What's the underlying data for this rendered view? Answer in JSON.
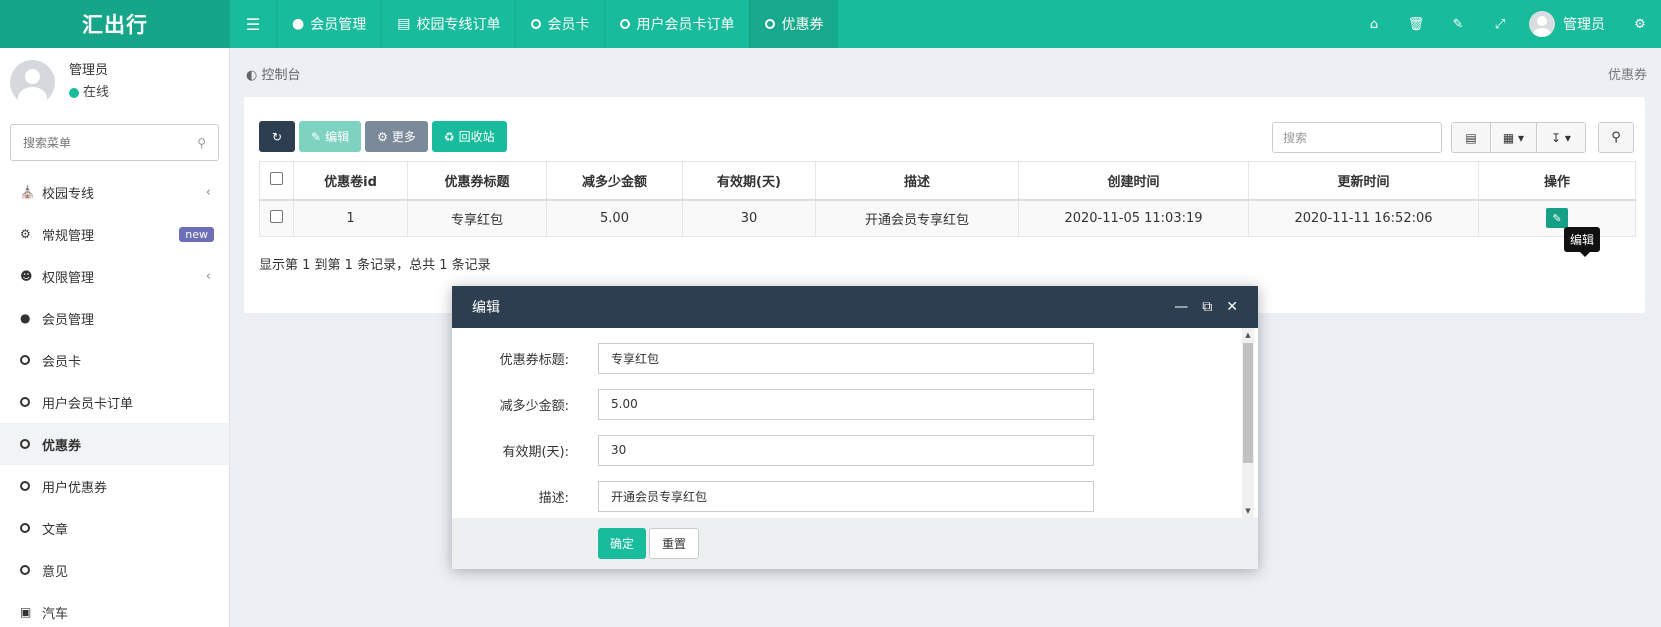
{
  "app": {
    "logo": "汇出行"
  },
  "topnav": {
    "items": [
      {
        "label": "会员管理",
        "icon": "user-icon"
      },
      {
        "label": "校园专线订单",
        "icon": "server-icon"
      },
      {
        "label": "会员卡",
        "icon": "circle-o-icon"
      },
      {
        "label": "用户会员卡订单",
        "icon": "circle-o-icon"
      },
      {
        "label": "优惠券",
        "icon": "circle-o-icon",
        "active": true
      }
    ],
    "user_name": "管理员"
  },
  "sidebar": {
    "user_name": "管理员",
    "user_status": "在线",
    "search_placeholder": "搜索菜单",
    "items": [
      {
        "label": "校园专线",
        "icon": "bank-icon",
        "has_arrow": true
      },
      {
        "label": "常规管理",
        "icon": "cogs-icon",
        "badge": "new"
      },
      {
        "label": "权限管理",
        "icon": "group-icon",
        "has_arrow": true
      },
      {
        "label": "会员管理",
        "icon": "user-icon"
      },
      {
        "label": "会员卡",
        "icon": "circle-o-icon"
      },
      {
        "label": "用户会员卡订单",
        "icon": "circle-o-icon"
      },
      {
        "label": "优惠券",
        "icon": "circle-o-icon",
        "active": true
      },
      {
        "label": "用户优惠券",
        "icon": "circle-o-icon"
      },
      {
        "label": "文章",
        "icon": "circle-o-icon"
      },
      {
        "label": "意见",
        "icon": "circle-o-icon"
      },
      {
        "label": "汽车",
        "icon": "car-icon"
      }
    ]
  },
  "breadcrumb": {
    "label": "控制台",
    "right": "优惠券"
  },
  "toolbar": {
    "edit": "编辑",
    "more": "更多",
    "recycle": "回收站",
    "search_placeholder": "搜索"
  },
  "table": {
    "headers": [
      "优惠卷id",
      "优惠券标题",
      "减多少金额",
      "有效期(天)",
      "描述",
      "创建时间",
      "更新时间",
      "操作"
    ],
    "rows": [
      [
        "1",
        "专享红包",
        "5.00",
        "30",
        "开通会员专享红包",
        "2020-11-05 11:03:19",
        "2020-11-11 16:52:06"
      ]
    ],
    "tooltip": "编辑",
    "records": "显示第 1 到第 1 条记录，总共 1 条记录"
  },
  "modal": {
    "title": "编辑",
    "fields": [
      {
        "label": "优惠券标题:",
        "value": "专享红包"
      },
      {
        "label": "减多少金额:",
        "value": "5.00"
      },
      {
        "label": "有效期(天):",
        "value": "30"
      },
      {
        "label": "描述:",
        "value": "开通会员专享红包"
      }
    ],
    "ok": "确定",
    "reset": "重置"
  },
  "colors": {
    "primary": "#18bc9c",
    "dark": "#2c3e50",
    "badge": "#6c6fb5"
  }
}
